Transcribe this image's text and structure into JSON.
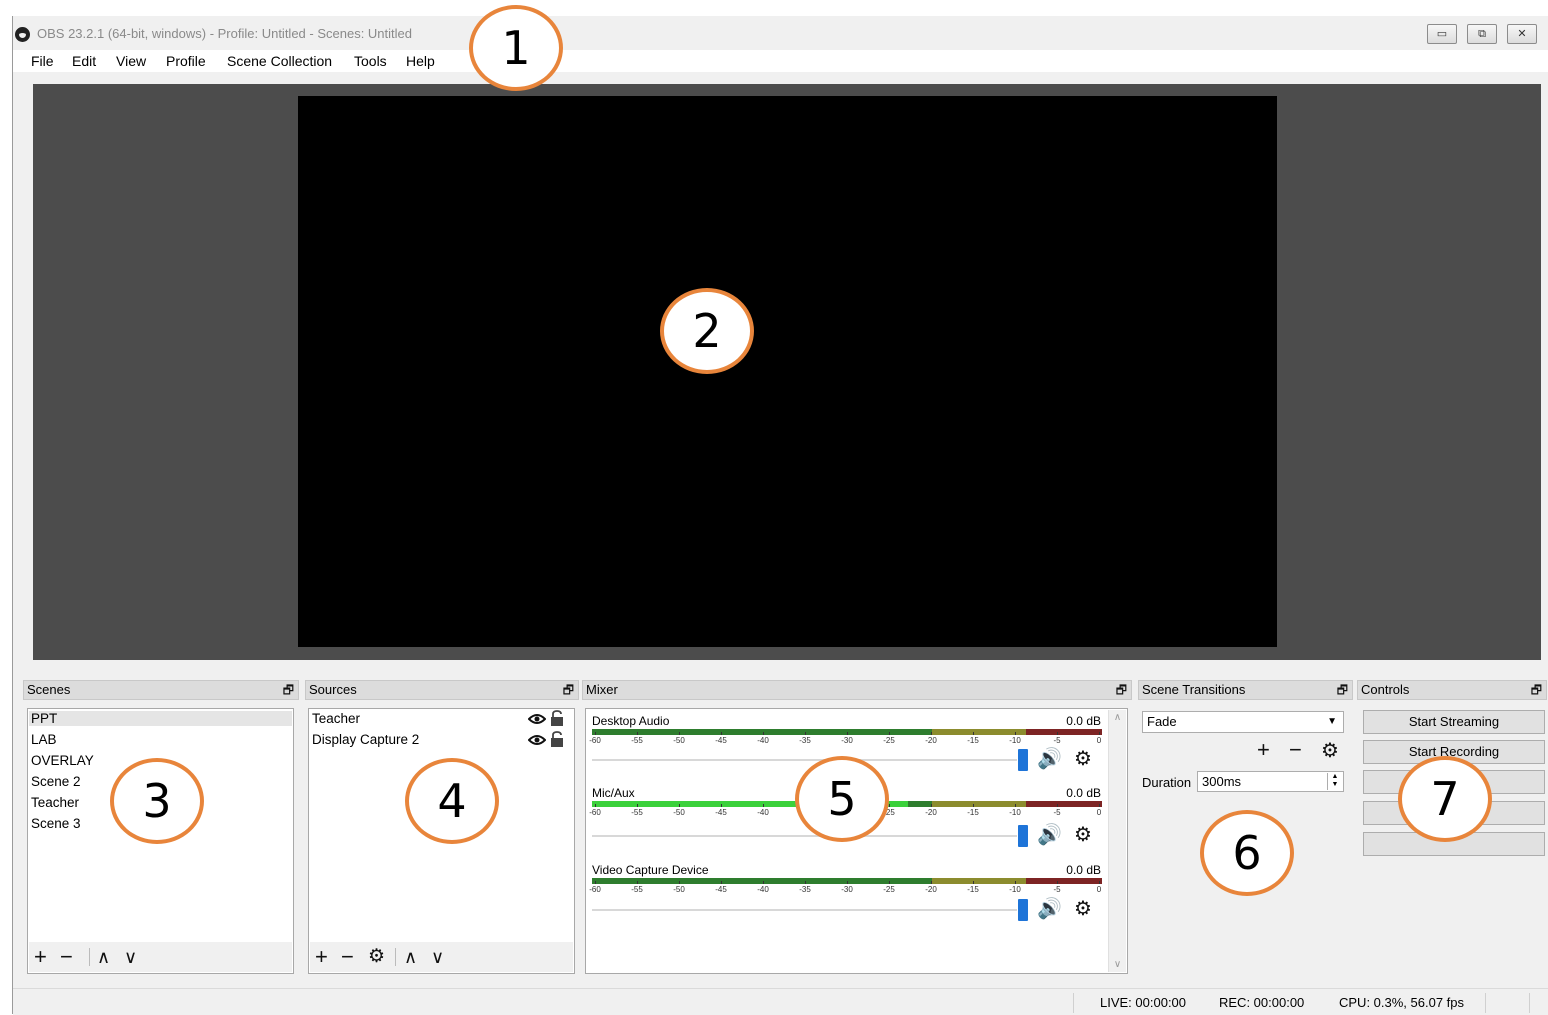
{
  "window": {
    "title": "OBS 23.2.1 (64-bit, windows) - Profile: Untitled - Scenes: Untitled",
    "minimize_glyph": "▭",
    "restore_glyph": "⧉",
    "close_glyph": "✕"
  },
  "menu": [
    "File",
    "Edit",
    "View",
    "Profile",
    "Scene Collection",
    "Tools",
    "Help"
  ],
  "docks": {
    "float_glyph": "🗗",
    "scenes": {
      "title": "Scenes",
      "items": [
        "PPT",
        "LAB",
        "OVERLAY",
        "Scene 2",
        "Teacher",
        "Scene 3"
      ],
      "selected": "PPT",
      "toolbar": {
        "add": "+",
        "remove": "−",
        "up": "∧",
        "down": "∨"
      }
    },
    "sources": {
      "title": "Sources",
      "items": [
        {
          "name": "Teacher",
          "visibility_icon": "eye-icon",
          "lock_icon": "lock-icon"
        },
        {
          "name": "Display Capture 2",
          "visibility_icon": "eye-icon",
          "lock_icon": "lock-icon"
        }
      ],
      "toolbar": {
        "add": "+",
        "remove": "−",
        "settings": "⚙",
        "up": "∧",
        "down": "∨"
      }
    },
    "mixer": {
      "title": "Mixer",
      "tick_labels": [
        "-60",
        "-55",
        "-50",
        "-45",
        "-40",
        "-35",
        "-30",
        "-25",
        "-20",
        "-15",
        "-10",
        "-5",
        "0"
      ],
      "channels": [
        {
          "name": "Desktop Audio",
          "db": "0.0 dB",
          "level_fraction": 0.0,
          "volume_fraction": 1.0
        },
        {
          "name": "Mic/Aux",
          "db": "0.0 dB",
          "level_fraction": 0.62,
          "volume_fraction": 1.0
        },
        {
          "name": "Video Capture Device",
          "db": "0.0 dB",
          "level_fraction": 0.0,
          "volume_fraction": 1.0
        }
      ]
    },
    "transitions": {
      "title": "Scene Transitions",
      "selected": "Fade",
      "duration_label": "Duration",
      "duration_value": "300ms",
      "add": "+",
      "remove": "−",
      "settings": "⚙"
    },
    "controls": {
      "title": "Controls",
      "buttons": [
        "Start Streaming",
        "Start Recording",
        "",
        "",
        ""
      ]
    }
  },
  "status": {
    "live": "LIVE: 00:00:00",
    "rec": "REC: 00:00:00",
    "cpu": "CPU: 0.3%, 56.07 fps"
  },
  "callouts": [
    "1",
    "2",
    "3",
    "4",
    "5",
    "6",
    "7"
  ],
  "colors": {
    "callout_border": "#e8853b",
    "meter_green": "#3bd13b",
    "meter_yellow": "#c8c83a",
    "meter_red": "#c83232",
    "volume_thumb": "#1e74d8"
  }
}
